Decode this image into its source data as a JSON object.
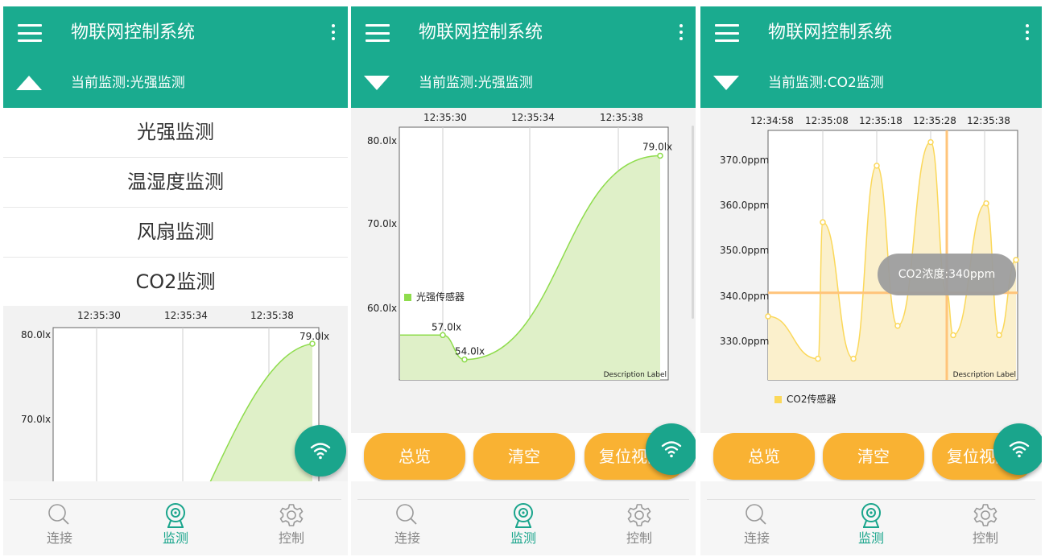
{
  "colors": {
    "primary": "#1aab8f",
    "accent": "#f9b233",
    "nav_active": "#1aa58c",
    "light_fill": "#dff0c8",
    "light_line": "#8edc4c",
    "co2_fill": "#fbf0cc",
    "co2_line": "#fbd85a",
    "cursor_line": "#ffc47a"
  },
  "icons": {
    "menu": "hamburger-icon",
    "more": "more-vert-icon",
    "expand": "triangle-up-icon",
    "collapse": "triangle-down-icon",
    "fab": "wifi-icon",
    "nav": [
      "search-icon",
      "camera-icon",
      "gear-icon"
    ]
  },
  "panels": [
    {
      "app_title": "物联网控制系统",
      "sub_title": "当前监测:光强监测",
      "dropdown_items": [
        "光强监测",
        "温湿度监测",
        "风扇监测",
        "CO2监测"
      ],
      "nav": {
        "items": [
          "连接",
          "监测",
          "控制"
        ],
        "active": "监测"
      }
    },
    {
      "app_title": "物联网控制系统",
      "sub_title": "当前监测:光强监测",
      "buttons": [
        "总览",
        "清空",
        "复位视图"
      ],
      "nav": {
        "items": [
          "连接",
          "监测",
          "控制"
        ],
        "active": "监测"
      }
    },
    {
      "app_title": "物联网控制系统",
      "sub_title": "当前监测:CO2监测",
      "buttons": [
        "总览",
        "清空",
        "复位视图"
      ],
      "tooltip": "CO2浓度:340ppm",
      "nav": {
        "items": [
          "连接",
          "监测",
          "控制"
        ],
        "active": "监测"
      }
    }
  ],
  "chart_data": [
    {
      "type": "line",
      "panel": 1,
      "x_tick_labels": [
        "12:35:30",
        "12:35:34",
        "12:35:38"
      ],
      "y_tick_labels": [
        "80.0lx",
        "70.0lx"
      ],
      "ylim": [
        60,
        80
      ],
      "series": [
        {
          "values": [
            {
              "t": "12:35:40",
              "y": 79.0
            }
          ],
          "point_labels": [
            "79.0lx"
          ]
        }
      ],
      "grid": "vertical"
    },
    {
      "type": "area",
      "panel": 2,
      "x_tick_labels": [
        "12:35:30",
        "12:35:34",
        "12:35:38"
      ],
      "y_tick_labels": [
        "80.0lx",
        "70.0lx",
        "60.0lx"
      ],
      "ylim": [
        51.5,
        82.5
      ],
      "series": [
        {
          "name": "光强传感器",
          "points": [
            {
              "t": "12:35:27",
              "y": 57.0
            },
            {
              "t": "12:35:30",
              "y": 57.0
            },
            {
              "t": "12:35:31",
              "y": 54.0
            },
            {
              "t": "12:35:40",
              "y": 79.0
            }
          ],
          "point_labels": [
            "57.0lx",
            "54.0lx",
            "79.0lx"
          ]
        }
      ],
      "description": "Description Label",
      "legend": "bottom-left",
      "grid": "vertical"
    },
    {
      "type": "area",
      "panel": 3,
      "x_tick_labels": [
        "12:34:58",
        "12:35:08",
        "12:35:18",
        "12:35:28",
        "12:35:38"
      ],
      "y_tick_labels": [
        "370.0ppm",
        "360.0ppm",
        "350.0ppm",
        "340.0ppm",
        "330.0ppm"
      ],
      "ylim": [
        321.5,
        374.5
      ],
      "series": [
        {
          "name": "CO2传感器",
          "values": [
            335,
            326,
            355,
            326,
            367,
            333,
            372,
            340,
            331,
            359,
            331,
            347
          ]
        }
      ],
      "highlight": {
        "y": 340,
        "t": "12:35:38"
      },
      "description": "Description Label",
      "legend": "bottom-left",
      "grid": "vertical"
    }
  ]
}
